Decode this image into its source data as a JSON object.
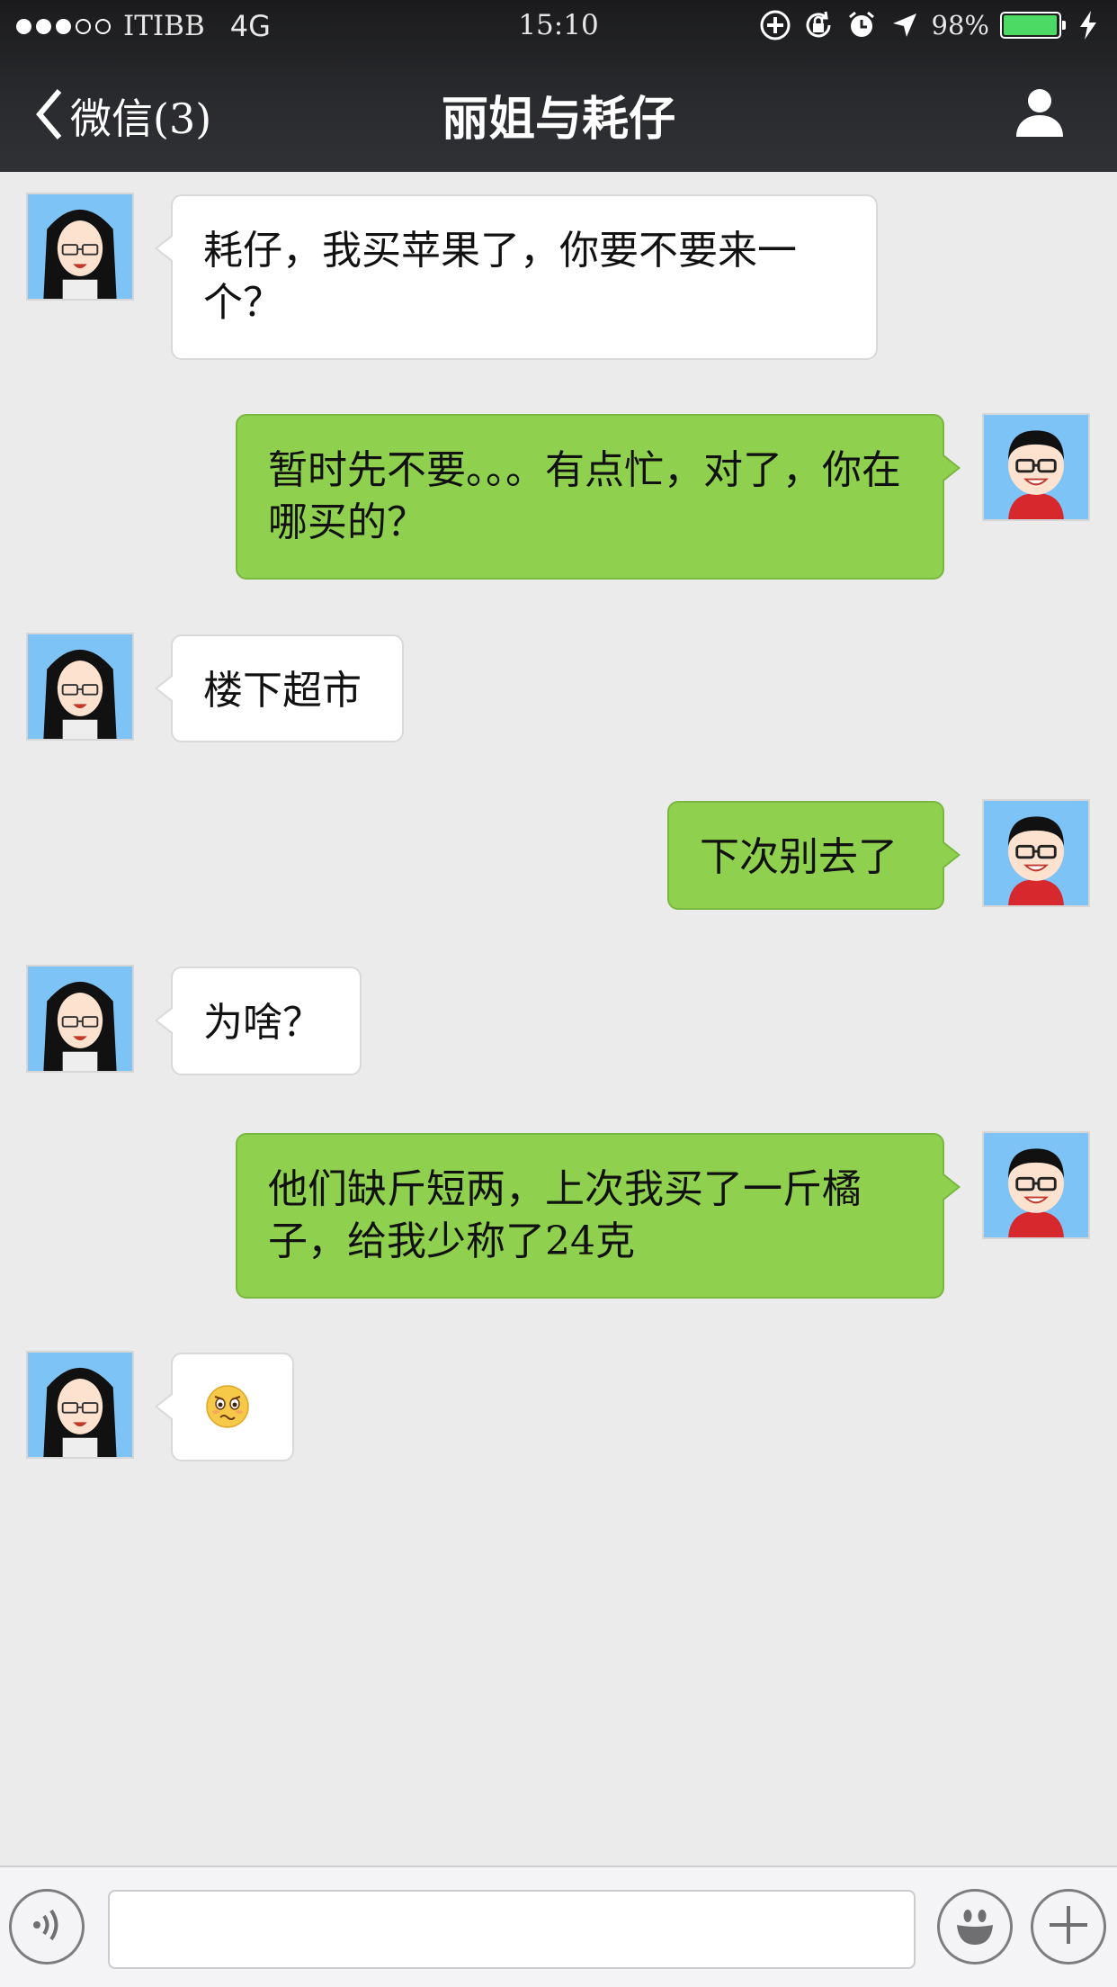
{
  "status_bar": {
    "carrier": "ITIBB",
    "network": "4G",
    "time": "15:10",
    "battery_percent": "98%",
    "battery_level": 0.98,
    "battery_color": "#4cd964",
    "signal_bars_filled": 3,
    "signal_bars_total": 5
  },
  "nav": {
    "back_label": "微信(3)",
    "title": "丽姐与耗仔",
    "profile_icon": "person-icon"
  },
  "colors": {
    "outgoing_bubble": "#8fd14f",
    "incoming_bubble": "#ffffff",
    "background": "#ebebeb",
    "nav_bar": "#2a2b2e"
  },
  "messages": [
    {
      "sender": "丽姐",
      "direction": "in",
      "text": "耗仔，我买苹果了，你要不要来一个？"
    },
    {
      "sender": "耗仔",
      "direction": "out",
      "text": "暂时先不要。。。有点忙，对了，你在哪买的？"
    },
    {
      "sender": "丽姐",
      "direction": "in",
      "text": "楼下超市"
    },
    {
      "sender": "耗仔",
      "direction": "out",
      "text": "下次别去了"
    },
    {
      "sender": "丽姐",
      "direction": "in",
      "text": "为啥？"
    },
    {
      "sender": "耗仔",
      "direction": "out",
      "text": "他们缺斤短两，上次我买了一斤橘子，给我少称了24克"
    },
    {
      "sender": "丽姐",
      "direction": "in",
      "emoji": "worried-face-emoji"
    }
  ],
  "toolbar": {
    "voice_icon": "voice-icon",
    "input_value": "",
    "emoji_icon": "smiley-icon",
    "plus_icon": "plus-icon"
  }
}
